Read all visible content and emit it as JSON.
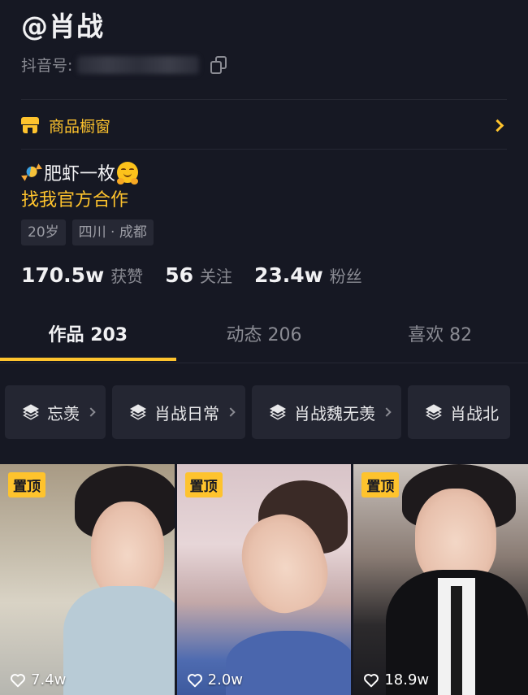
{
  "profile": {
    "handle": "@肖战",
    "id_label": "抖音号:",
    "shop_label": "商品橱窗",
    "bio_line1": "肥虾一枚",
    "bio_line2": "找我官方合作",
    "tags": [
      "20岁",
      "四川 · 成都"
    ]
  },
  "stats": [
    {
      "num": "170.5w",
      "label": "获赞"
    },
    {
      "num": "56",
      "label": "关注"
    },
    {
      "num": "23.4w",
      "label": "粉丝"
    }
  ],
  "tabs": [
    {
      "label": "作品 203",
      "active": true
    },
    {
      "label": "动态 206",
      "active": false
    },
    {
      "label": "喜欢 82",
      "active": false
    }
  ],
  "collections": [
    "忘羡",
    "肖战日常",
    "肖战魏无羡",
    "肖战北"
  ],
  "videos": [
    {
      "pin": "置顶",
      "likes": "7.4w"
    },
    {
      "pin": "置顶",
      "likes": "2.0w"
    },
    {
      "pin": "置顶",
      "likes": "18.9w"
    }
  ],
  "colors": {
    "background": "#161823",
    "accent": "#fec32d",
    "muted": "#8a8b93"
  }
}
